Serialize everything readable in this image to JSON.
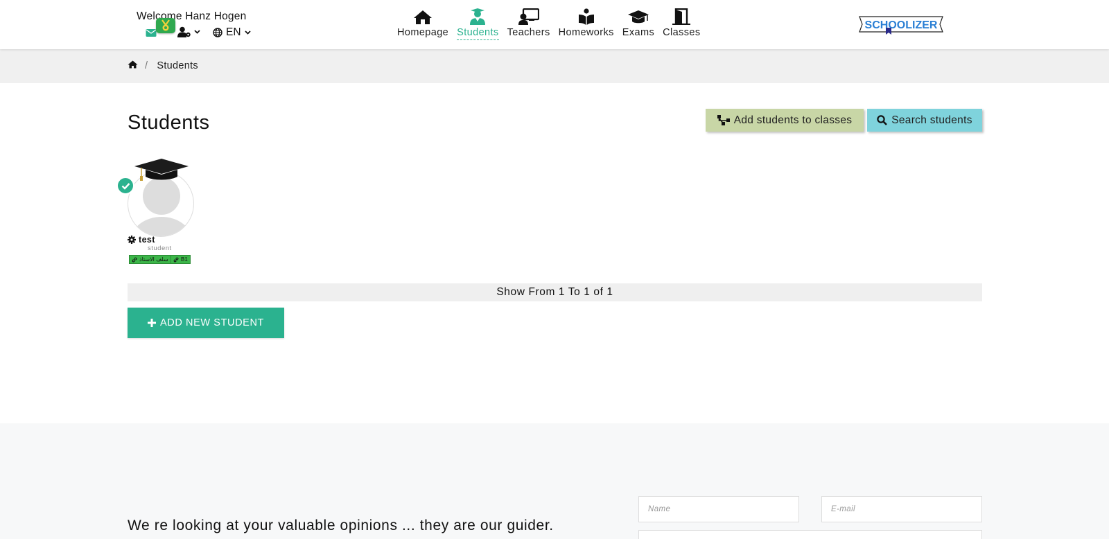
{
  "header": {
    "welcome": "Welcome Hanz Hogen",
    "language": "EN",
    "nav": [
      {
        "label": "Homepage",
        "icon": "home-icon"
      },
      {
        "label": "Students",
        "icon": "student-icon",
        "active": true
      },
      {
        "label": "Teachers",
        "icon": "teacher-icon"
      },
      {
        "label": "Homeworks",
        "icon": "book-icon"
      },
      {
        "label": "Exams",
        "icon": "graduation-cap-icon"
      },
      {
        "label": "Classes",
        "icon": "door-icon"
      }
    ],
    "logo_text": "SCHOOLIZER"
  },
  "breadcrumb": {
    "current": "Students"
  },
  "main": {
    "title": "Students",
    "add_to_classes_label": "Add students to classes",
    "search_label": "Search students",
    "students": [
      {
        "name": "test",
        "role": "student",
        "tags": [
          "سلف الاستاذ",
          "B1"
        ]
      }
    ],
    "pager_text": "Show From 1 To 1 of 1",
    "add_new_label": "ADD NEW STUDENT"
  },
  "footer": {
    "text": "We re looking at your valuable opinions ... they are our guider.",
    "name_placeholder": "Name",
    "email_placeholder": "E-mail"
  },
  "colors": {
    "accent": "#2bb28f",
    "add_classes_button": "#c8d6a6",
    "search_button": "#7fd3dc",
    "tag_green": "#3cb649"
  }
}
